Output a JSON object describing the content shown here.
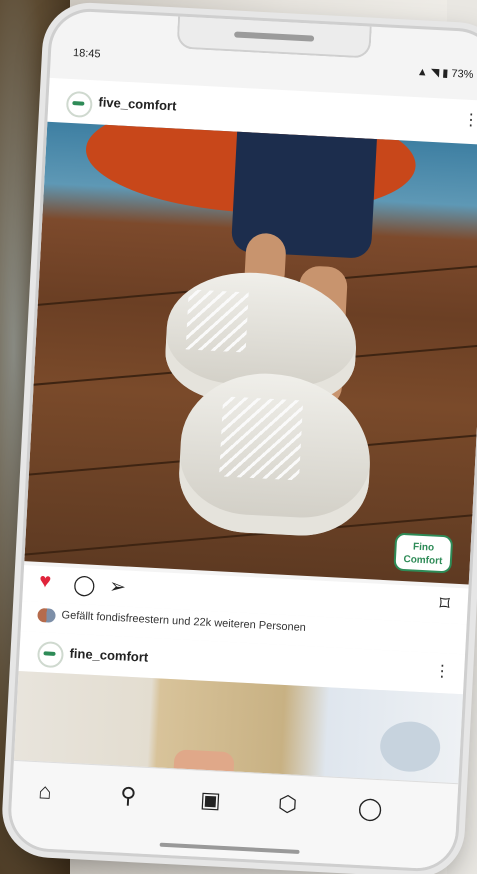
{
  "status_bar": {
    "time": "18:45",
    "icons": "▲ ◥ ▮ 73%"
  },
  "post1": {
    "username": "five_comfort",
    "more_icon": "more-options",
    "badge_line1": "Fino",
    "badge_line2": "Comfort"
  },
  "actions": {
    "like_icon": "heart-filled",
    "like_glyph": "♥",
    "comment_icon": "comment",
    "comment_glyph": "◯",
    "share_icon": "send",
    "share_glyph": "➢",
    "save_icon": "bookmark",
    "save_glyph": "⌑"
  },
  "likes": {
    "text": "Gefällt fondisfreestern und 22k weiteren Personen"
  },
  "post2": {
    "username": "fine_comfort",
    "more_glyph": "⋮"
  },
  "nav": {
    "home_glyph": "⌂",
    "search_glyph": "⚲",
    "reels_glyph": "▣",
    "shop_glyph": "⬡",
    "profile_glyph": "◯"
  },
  "colors": {
    "accent": "#2e8b57",
    "like": "#e0243b"
  }
}
